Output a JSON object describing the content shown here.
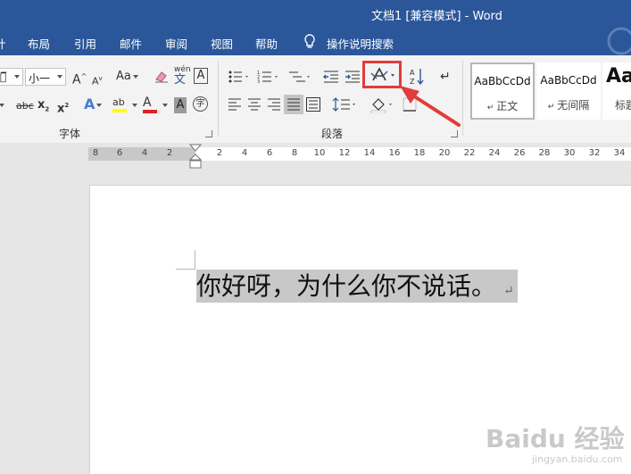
{
  "window": {
    "title": "文档1 [兼容模式]  -  Word"
  },
  "tabs": [
    {
      "label": "计"
    },
    {
      "label": "布局"
    },
    {
      "label": "引用"
    },
    {
      "label": "邮件"
    },
    {
      "label": "审阅"
    },
    {
      "label": "视图"
    },
    {
      "label": "帮助"
    }
  ],
  "tell_me": {
    "label": "操作说明搜索",
    "icon": "lightbulb-icon"
  },
  "ribbon": {
    "font_group": {
      "label": "字体",
      "font_name": "正̅",
      "font_size": "小一",
      "grow_font": "A",
      "shrink_font": "A",
      "change_case": "Aa",
      "phonetic_guide": "wén",
      "phonetic_char": "文",
      "char_border": "A",
      "strikethrough": "abc",
      "subscript": "x",
      "superscript": "x",
      "text_effects": "A",
      "highlight": "ab",
      "font_color": "A",
      "char_shading": "A",
      "enclose_char": "字"
    },
    "paragraph_group": {
      "label": "段落"
    },
    "styles": [
      {
        "sample": "AaBbCcDd",
        "name": "正文"
      },
      {
        "sample": "AaBbCcDd",
        "name": "无间隔"
      },
      {
        "sample": "Aa",
        "name": "标题"
      }
    ],
    "colors": {
      "highlight_color": "#ffff00",
      "font_color": "#e01f1f",
      "accent": "#2b579a",
      "annotation": "#e23b3b"
    }
  },
  "ruler": {
    "left_numbers": [
      "8",
      "6",
      "4",
      "2"
    ],
    "right_numbers": [
      "2",
      "4",
      "6",
      "8",
      "10",
      "12",
      "14",
      "16",
      "18",
      "20",
      "22",
      "24",
      "26",
      "28",
      "30",
      "32",
      "34"
    ]
  },
  "document": {
    "text": "你好呀，为什么你不说话。",
    "para_mark": "↵"
  },
  "watermark": {
    "logo": "Baidu 经验",
    "url": "jingyan.baidu.com"
  }
}
